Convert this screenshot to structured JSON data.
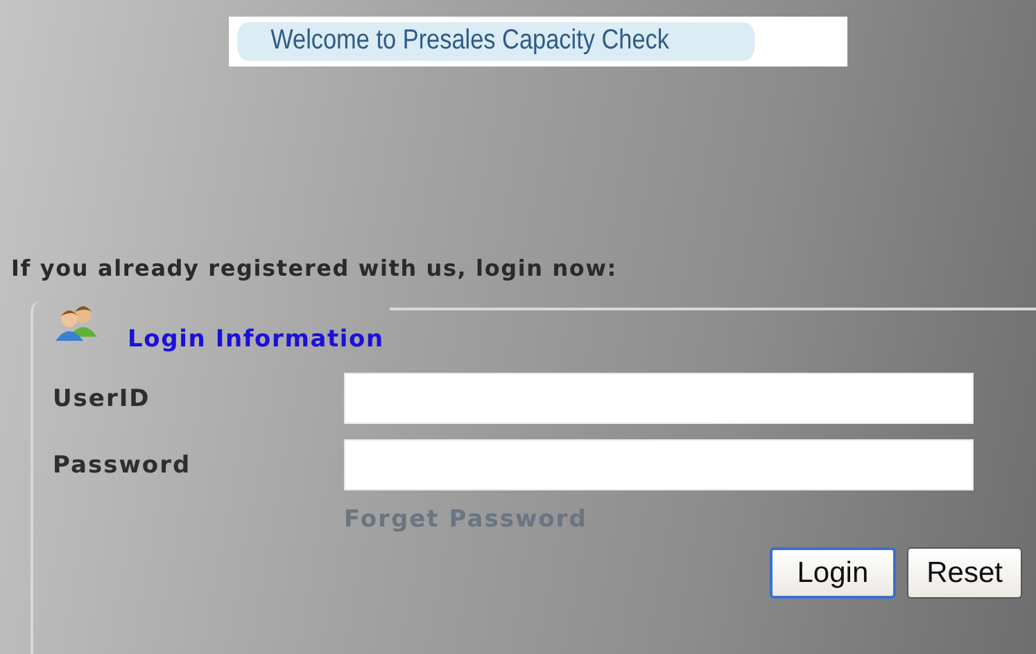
{
  "banner": {
    "title": "Welcome to Presales Capacity Check"
  },
  "prompt": "If you already registered with us, login now:",
  "login": {
    "legend": "Login Information",
    "fields": [
      {
        "label": "UserID"
      },
      {
        "label": "Password"
      }
    ],
    "forgot_link": "Forget Password",
    "buttons": [
      {
        "label": "Login",
        "focused": true
      },
      {
        "label": "Reset",
        "focused": false
      }
    ]
  }
}
